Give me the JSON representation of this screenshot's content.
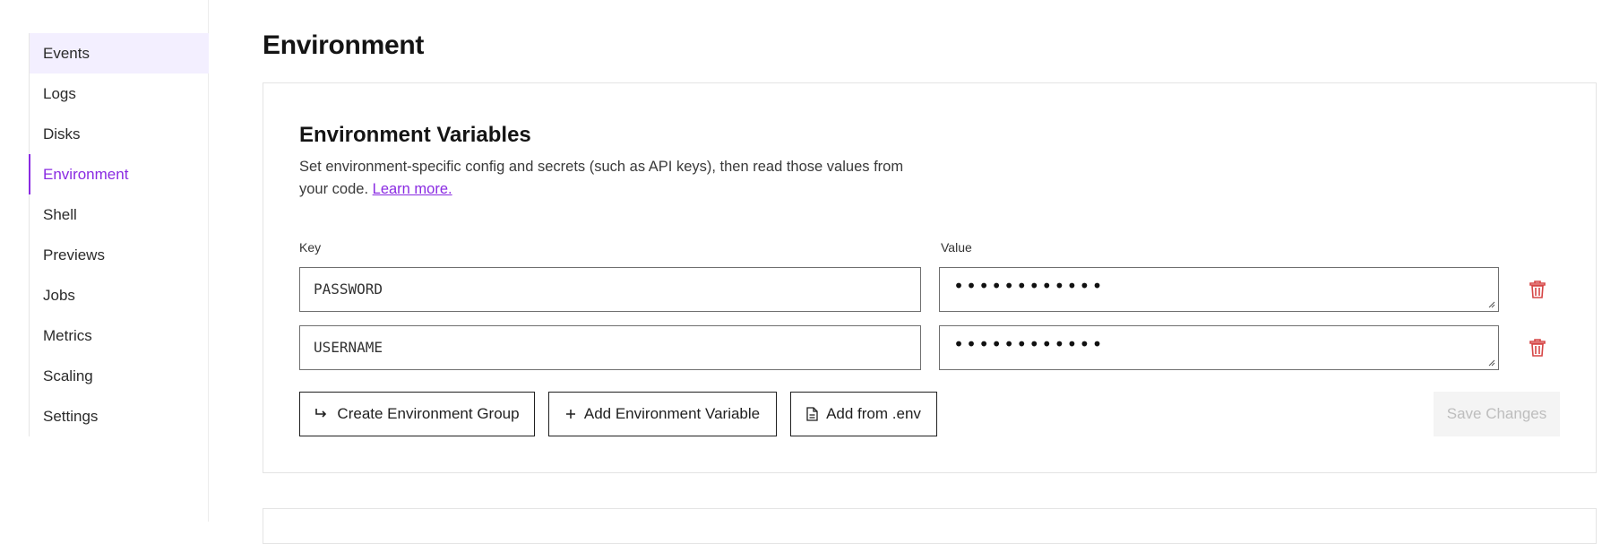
{
  "sidebar": {
    "items": [
      {
        "label": "Events"
      },
      {
        "label": "Logs"
      },
      {
        "label": "Disks"
      },
      {
        "label": "Environment"
      },
      {
        "label": "Shell"
      },
      {
        "label": "Previews"
      },
      {
        "label": "Jobs"
      },
      {
        "label": "Metrics"
      },
      {
        "label": "Scaling"
      },
      {
        "label": "Settings"
      }
    ],
    "active": "Environment",
    "hovered": "Events"
  },
  "page": {
    "title": "Environment"
  },
  "env_vars": {
    "title": "Environment Variables",
    "description_line1": "Set environment-specific config and secrets (such as API keys), then read those values from",
    "description_line2": "your code.",
    "learn_more": "Learn more.",
    "key_label": "Key",
    "value_label": "Value",
    "rows": [
      {
        "key": "PASSWORD",
        "value": "••••••••••••"
      },
      {
        "key": "USERNAME",
        "value": "••••••••••••"
      }
    ]
  },
  "actions": {
    "create_group": "Create Environment Group",
    "add_variable": "Add Environment Variable",
    "add_from_env": "Add from .env",
    "save": "Save Changes"
  },
  "colors": {
    "accent": "#8a2be2",
    "hover_bg": "#f3efff",
    "delete": "#d64545",
    "disabled_text": "#bdbdbd"
  }
}
